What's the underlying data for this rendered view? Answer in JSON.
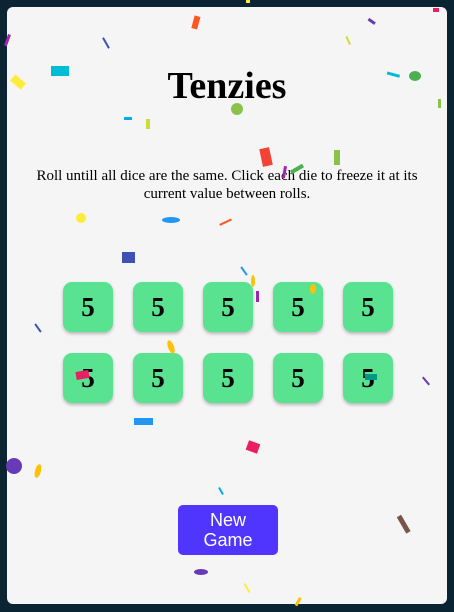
{
  "game": {
    "title": "Tenzies",
    "instructions": "Roll untill all dice are the same. Click each die to freeze it at its current value between rolls.",
    "new_game_label": "New Game"
  },
  "dice": [
    {
      "value": "5",
      "held": true
    },
    {
      "value": "5",
      "held": true
    },
    {
      "value": "5",
      "held": true
    },
    {
      "value": "5",
      "held": true
    },
    {
      "value": "5",
      "held": true
    },
    {
      "value": "5",
      "held": true
    },
    {
      "value": "5",
      "held": true
    },
    {
      "value": "5",
      "held": true
    },
    {
      "value": "5",
      "held": true
    },
    {
      "value": "5",
      "held": true
    }
  ],
  "colors": {
    "background": "#0b2434",
    "card": "#f5f5f5",
    "held_die": "#59e391",
    "button": "#5035ff"
  }
}
